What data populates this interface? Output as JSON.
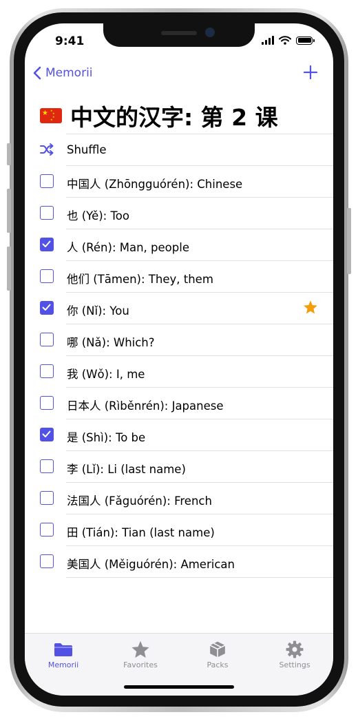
{
  "status_bar": {
    "time": "9:41"
  },
  "nav": {
    "back_label": "Memorii"
  },
  "page": {
    "flag": "china-flag-icon",
    "title": "中文的汉字: 第 2 课"
  },
  "shuffle": {
    "label": "Shuffle"
  },
  "cards": [
    {
      "label": "中国人 (Zhōngguórén): Chinese",
      "checked": false,
      "favorite": false
    },
    {
      "label": "也 (Yě): Too",
      "checked": false,
      "favorite": false
    },
    {
      "label": "人 (Rén): Man, people",
      "checked": true,
      "favorite": false
    },
    {
      "label": "他们 (Tāmen): They, them",
      "checked": false,
      "favorite": false
    },
    {
      "label": "你 (Nǐ): You",
      "checked": true,
      "favorite": true
    },
    {
      "label": "哪 (Nǎ): Which?",
      "checked": false,
      "favorite": false
    },
    {
      "label": "我 (Wǒ): I, me",
      "checked": false,
      "favorite": false
    },
    {
      "label": "日本人 (Rìběnrén): Japanese",
      "checked": false,
      "favorite": false
    },
    {
      "label": "是 (Shì): To be",
      "checked": true,
      "favorite": false
    },
    {
      "label": "李 (Lǐ): Li (last name)",
      "checked": false,
      "favorite": false
    },
    {
      "label": "法国人 (Fǎguórén): French",
      "checked": false,
      "favorite": false
    },
    {
      "label": "田 (Tián): Tian (last name)",
      "checked": false,
      "favorite": false
    },
    {
      "label": "美国人 (Měiguórén): American",
      "checked": false,
      "favorite": false
    }
  ],
  "tabbar": {
    "tabs": [
      {
        "label": "Memorii",
        "icon": "folder-icon",
        "active": true
      },
      {
        "label": "Favorites",
        "icon": "star-icon",
        "active": false
      },
      {
        "label": "Packs",
        "icon": "package-icon",
        "active": false
      },
      {
        "label": "Settings",
        "icon": "gear-icon",
        "active": false
      }
    ]
  },
  "colors": {
    "accent": "#5151e6",
    "favorite": "#f59e0b",
    "inactive_tab": "#8e8e93"
  }
}
